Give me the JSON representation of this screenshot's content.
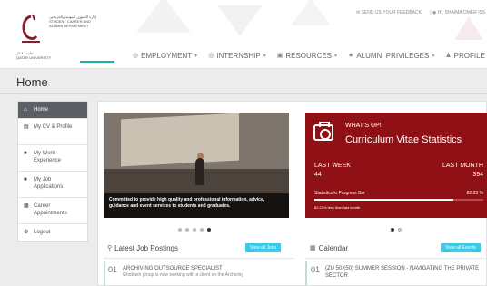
{
  "header": {
    "logo": {
      "arabic_line": "إدارة الشؤون المهنية والخريجين",
      "english_line1": "STUDENT CAREER AND",
      "english_line2": "ALUMNI DEPARTMENT",
      "university_ar": "جامعة قطر",
      "university_en": "QATAR UNIVERSITY"
    },
    "top_links": {
      "feedback": "SEND US YOUR FEEDBACK",
      "user": "HI, SHAIMA OMER ISS"
    },
    "nav": [
      {
        "label": "EMPLOYMENT",
        "icon": "target-icon"
      },
      {
        "label": "INTERNSHIP",
        "icon": "target-icon"
      },
      {
        "label": "RESOURCES",
        "icon": "briefcase-icon"
      },
      {
        "label": "ALUMNI PRIVILEGES",
        "icon": "star-icon"
      },
      {
        "label": "PROFILE",
        "icon": "user-icon"
      }
    ]
  },
  "page": {
    "title": "Home"
  },
  "sidebar": {
    "items": [
      {
        "label": "Home",
        "icon": "home-icon"
      },
      {
        "label": "My CV & Profile",
        "icon": "cv-icon"
      },
      {
        "label": "My Work Experience",
        "icon": "briefcase-icon"
      },
      {
        "label": "My Job Applications",
        "icon": "briefcase-icon"
      },
      {
        "label": "Career Appointments",
        "icon": "calendar-icon"
      },
      {
        "label": "Logout",
        "icon": "logout-icon"
      }
    ]
  },
  "slider": {
    "caption": "Committed to provide high quality and professional information, advice, guidance and event services to students and graduates."
  },
  "stats": {
    "whats_up": "WHAT'S UP!",
    "title": "Curriculum Vitae Statistics",
    "last_week_label": "LAST WEEK",
    "last_week_value": "44",
    "last_month_label": "LAST MONTH",
    "last_month_value": "394",
    "progress_label": "Statistics in Progress Bar",
    "progress_value_text": "82.23 %",
    "progress_fraction": 0.8223,
    "progress_note": "82.23% less than last month"
  },
  "jobs": {
    "title": "Latest Job Postings",
    "button": "View all Jobs",
    "items": [
      {
        "num": "01",
        "title": "ARCHIVING OUTSOURCE SPECIALIST",
        "desc": "Ghobash group is now working with a client on the Archiving"
      }
    ]
  },
  "calendar": {
    "title": "Calendar",
    "button": "View all Events",
    "items": [
      {
        "num": "01",
        "title": "(ZU 50X50) SUMMER SESSION - NAVIGATING THE PRIVATE SECTOR"
      }
    ]
  },
  "colors": {
    "accent_teal": "#1bb5a8",
    "stats_red": "#8f1115",
    "button_blue": "#3cc9e6",
    "sidebar_active": "#5c6066"
  }
}
